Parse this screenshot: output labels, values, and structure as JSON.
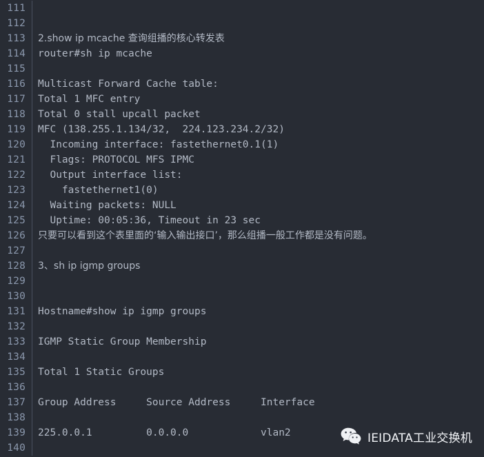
{
  "editor": {
    "theme_background": "#282c34",
    "gutter_text_color": "#8b98ad",
    "code_text_color": "#b3bac6",
    "divider_color": "#4a5160",
    "first_line_number": 111,
    "last_line_number": 140,
    "lines": [
      {
        "number": "111",
        "text": "",
        "cjk": false
      },
      {
        "number": "112",
        "text": "",
        "cjk": false
      },
      {
        "number": "113",
        "text": "2.show ip mcache 查询组播的核心转发表",
        "cjk": true
      },
      {
        "number": "114",
        "text": "router#sh ip mcache",
        "cjk": false
      },
      {
        "number": "115",
        "text": "",
        "cjk": false
      },
      {
        "number": "116",
        "text": "Multicast Forward Cache table:",
        "cjk": false
      },
      {
        "number": "117",
        "text": "Total 1 MFC entry",
        "cjk": false
      },
      {
        "number": "118",
        "text": "Total 0 stall upcall packet",
        "cjk": false
      },
      {
        "number": "119",
        "text": "MFC (138.255.1.134/32,  224.123.234.2/32)",
        "cjk": false
      },
      {
        "number": "120",
        "text": "  Incoming interface: fastethernet0.1(1)",
        "cjk": false
      },
      {
        "number": "121",
        "text": "  Flags: PROTOCOL MFS IPMC",
        "cjk": false
      },
      {
        "number": "122",
        "text": "  Output interface list:",
        "cjk": false
      },
      {
        "number": "123",
        "text": "    fastethernet1(0)",
        "cjk": false
      },
      {
        "number": "124",
        "text": "  Waiting packets: NULL",
        "cjk": false
      },
      {
        "number": "125",
        "text": "  Uptime: 00:05:36, Timeout in 23 sec",
        "cjk": false
      },
      {
        "number": "126",
        "text": "只要可以看到这个表里面的‘输入输出接口’，那么组播一般工作都是没有问题。",
        "cjk": true
      },
      {
        "number": "127",
        "text": "",
        "cjk": false
      },
      {
        "number": "128",
        "text": "3、sh ip igmp groups",
        "cjk": true
      },
      {
        "number": "129",
        "text": "",
        "cjk": false
      },
      {
        "number": "130",
        "text": "",
        "cjk": false
      },
      {
        "number": "131",
        "text": "Hostname#show ip igmp groups",
        "cjk": false
      },
      {
        "number": "132",
        "text": "",
        "cjk": false
      },
      {
        "number": "133",
        "text": "IGMP Static Group Membership",
        "cjk": false
      },
      {
        "number": "134",
        "text": "",
        "cjk": false
      },
      {
        "number": "135",
        "text": "Total 1 Static Groups",
        "cjk": false
      },
      {
        "number": "136",
        "text": "",
        "cjk": false
      },
      {
        "number": "137",
        "text": "Group Address     Source Address     Interface",
        "cjk": false
      },
      {
        "number": "138",
        "text": "",
        "cjk": false
      },
      {
        "number": "139",
        "text": "225.0.0.1         0.0.0.0            vlan2",
        "cjk": false
      },
      {
        "number": "140",
        "text": "",
        "cjk": false
      }
    ]
  },
  "watermark": {
    "icon": "wechat-icon",
    "label": "IEIDATA工业交换机",
    "text_color": "#f2f4f7"
  }
}
